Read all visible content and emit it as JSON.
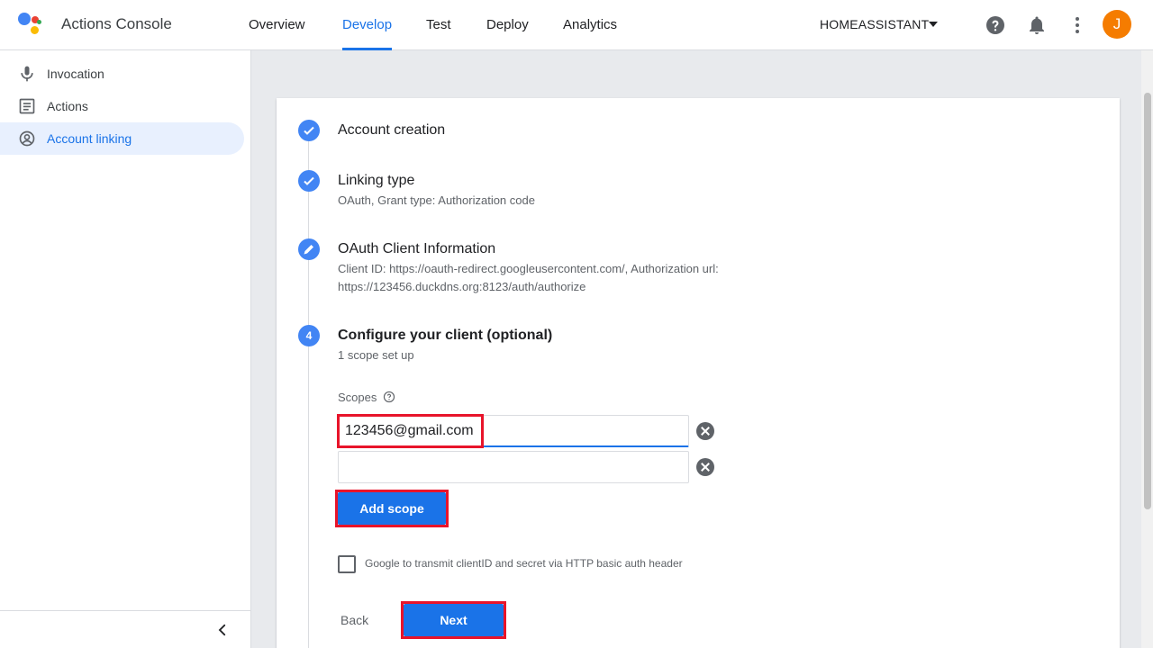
{
  "header": {
    "app_title": "Actions Console",
    "tabs": [
      {
        "label": "Overview"
      },
      {
        "label": "Develop",
        "active": true
      },
      {
        "label": "Test"
      },
      {
        "label": "Deploy"
      },
      {
        "label": "Analytics"
      }
    ],
    "project_name": "HOMEASSISTANT",
    "avatar_letter": "J",
    "icons": [
      "help-icon",
      "notifications-bell-icon",
      "more-vert-icon"
    ]
  },
  "sidebar": {
    "items": [
      {
        "label": "Invocation",
        "icon": "microphone-icon"
      },
      {
        "label": "Actions",
        "icon": "list-icon"
      },
      {
        "label": "Account linking",
        "icon": "account-circle-icon",
        "active": true
      }
    ]
  },
  "steps": [
    {
      "title": "Account creation",
      "subtitle": ""
    },
    {
      "title": "Linking type",
      "subtitle": "OAuth, Grant type: Authorization code"
    },
    {
      "title": "OAuth Client Information",
      "subtitle_line1": "Client ID: https://oauth-redirect.googleusercontent.com/, Authorization url:",
      "subtitle_line2": "https://123456.duckdns.org:8123/auth/authorize"
    },
    {
      "number": "4",
      "title": "Configure your client (optional)",
      "subtitle": "1 scope set up"
    }
  ],
  "scopes": {
    "label": "Scopes",
    "values": [
      "123456@gmail.com",
      ""
    ],
    "add_scope_label": "Add scope"
  },
  "basic_auth_checkbox": {
    "label": "Google to transmit clientID and secret via HTTP basic auth header",
    "checked": false
  },
  "footer_buttons": {
    "back_label": "Back",
    "next_label": "Next"
  },
  "colors": {
    "accent": "#1a73e8",
    "step_blue": "#4285f4",
    "highlight_red": "#e8142a",
    "avatar_orange": "#f57c00"
  }
}
